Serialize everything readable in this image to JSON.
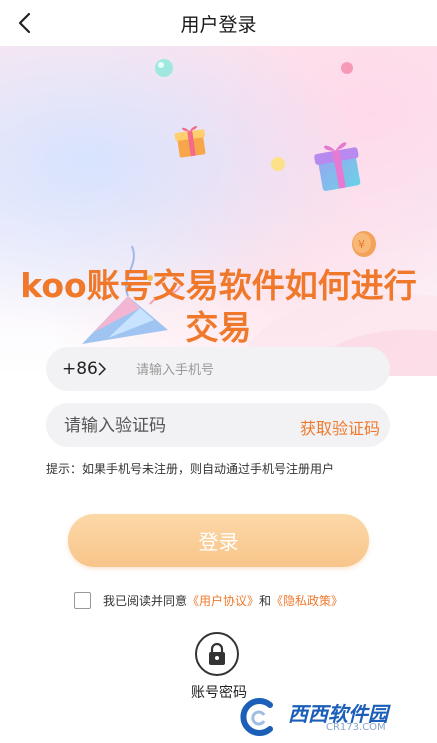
{
  "header": {
    "title": "用户登录"
  },
  "overlay": {
    "line1": "koo账号交易软件如何进行",
    "line2": "交易"
  },
  "form": {
    "country_code": "+86",
    "phone_placeholder": "请输入手机号",
    "code_placeholder": "请输入验证码",
    "get_code_label": "获取验证码",
    "hint": "提示：如果手机号未注册，则自动通过手机号注册用户",
    "login_label": "登录"
  },
  "agreement": {
    "prefix": "我已阅读并同意",
    "user_agreement": "《用户协议》",
    "and": "和",
    "privacy_policy": "《隐私政策》"
  },
  "alt_login": {
    "label": "账号密码"
  },
  "watermark": {
    "name": "西西软件园",
    "url": "CR173.COM"
  },
  "colors": {
    "accent": "#ee7a2e",
    "login_button": "#f8c58a",
    "input_bg": "#f2f2f4"
  }
}
